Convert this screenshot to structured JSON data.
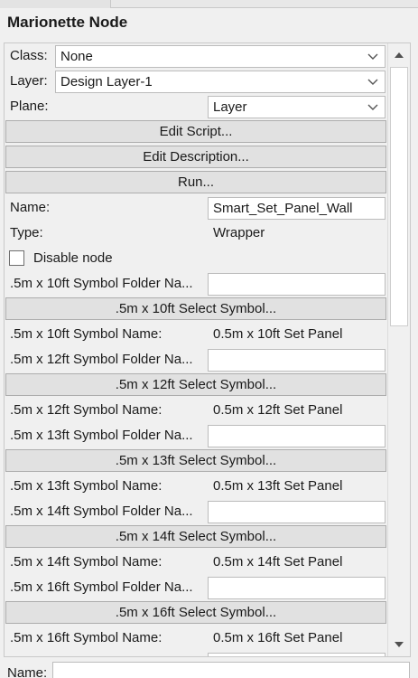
{
  "palette": {
    "title": "Marionette Node"
  },
  "fields": {
    "class": {
      "label": "Class:",
      "value": "None"
    },
    "layer": {
      "label": "Layer:",
      "value": "Design Layer-1"
    },
    "plane": {
      "label": "Plane:",
      "value": "Layer"
    }
  },
  "buttons": {
    "edit_script": "Edit Script...",
    "edit_description": "Edit Description...",
    "run": "Run..."
  },
  "name": {
    "label": "Name:",
    "value": "Smart_Set_Panel_Wall"
  },
  "type": {
    "label": "Type:",
    "value": "Wrapper"
  },
  "disable_node": {
    "label": "Disable node",
    "checked": false
  },
  "symbols": [
    {
      "folder_label": ".5m x 10ft Symbol Folder Na...",
      "folder_value": "",
      "select_label": ".5m x 10ft Select Symbol...",
      "name_label": ".5m x 10ft Symbol Name:",
      "name_value": "0.5m x 10ft Set Panel"
    },
    {
      "folder_label": ".5m x 12ft Symbol Folder Na...",
      "folder_value": "",
      "select_label": ".5m x 12ft Select Symbol...",
      "name_label": ".5m x 12ft Symbol Name:",
      "name_value": "0.5m x 12ft Set Panel"
    },
    {
      "folder_label": ".5m x 13ft Symbol Folder Na...",
      "folder_value": "",
      "select_label": ".5m x 13ft Select Symbol...",
      "name_label": ".5m x 13ft Symbol Name:",
      "name_value": "0.5m x 13ft Set Panel"
    },
    {
      "folder_label": ".5m x 14ft Symbol Folder Na...",
      "folder_value": "",
      "select_label": ".5m x 14ft Select Symbol...",
      "name_label": ".5m x 14ft Symbol Name:",
      "name_value": "0.5m x 14ft Set Panel"
    },
    {
      "folder_label": ".5m x 16ft Symbol Folder Na...",
      "folder_value": "",
      "select_label": ".5m x 16ft Select Symbol...",
      "name_label": ".5m x 16ft Symbol Name:",
      "name_value": "0.5m x 16ft Set Panel"
    }
  ],
  "footer": {
    "name_label": "Name:",
    "name_value": ""
  },
  "icons": {
    "dropdown": "chevron-down-icon",
    "scroll_up": "triangle-up-icon",
    "scroll_down": "triangle-down-icon"
  }
}
